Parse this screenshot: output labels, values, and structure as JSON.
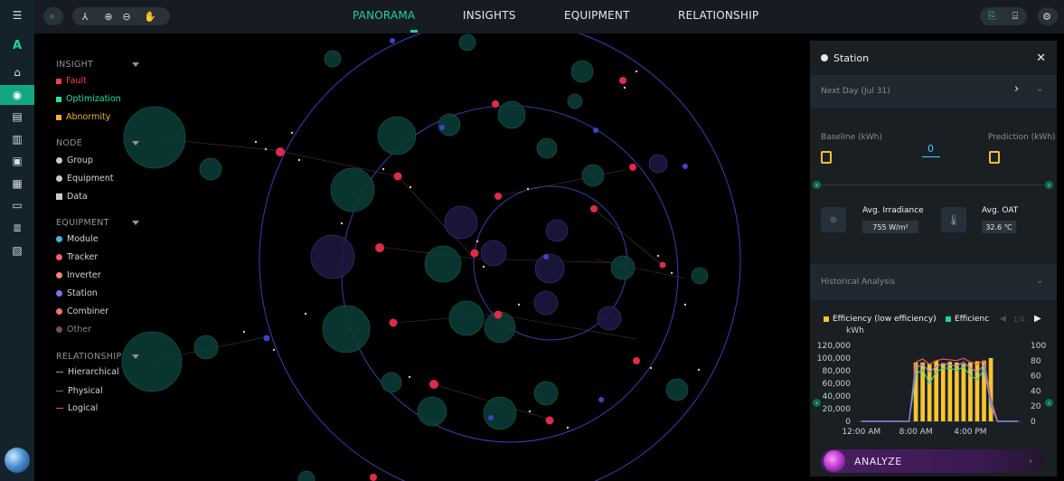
{
  "sidebar": {
    "logo": "A",
    "items": [
      {
        "icon": "menu-icon"
      },
      {
        "icon": "home-icon"
      },
      {
        "icon": "topology-icon"
      },
      {
        "icon": "report-icon"
      },
      {
        "icon": "bar-chart-icon"
      },
      {
        "icon": "monitor-icon"
      },
      {
        "icon": "analytics-icon"
      },
      {
        "icon": "screen-icon"
      },
      {
        "icon": "list-icon"
      },
      {
        "icon": "document-icon"
      }
    ]
  },
  "topbar": {
    "tabs": [
      "PANORAMA",
      "INSIGHTS",
      "EQUIPMENT",
      "RELATIONSHIP"
    ],
    "active_tab": "PANORAMA",
    "tools": [
      "search-icon",
      "hierarchy-icon",
      "zoom-in-icon",
      "zoom-out-icon",
      "pan-hand-icon"
    ],
    "right_tools": [
      "export-icon",
      "clipboard-icon",
      "settings-icon"
    ]
  },
  "legend": {
    "insight_title": "INSIGHT",
    "insight_items": [
      {
        "label": "Fault",
        "color": "#ff3b4e"
      },
      {
        "label": "Optimization",
        "color": "#1fe5a9"
      },
      {
        "label": "Abnormity",
        "color": "#f6b323"
      }
    ],
    "node_title": "NODE",
    "node_items": [
      {
        "label": "Group"
      },
      {
        "label": "Equipment"
      },
      {
        "label": "Data"
      }
    ],
    "equipment_title": "EQUIPMENT",
    "equipment_items": [
      {
        "label": "Module",
        "color": "#46b4d9"
      },
      {
        "label": "Tracker",
        "color": "#ff5a73"
      },
      {
        "label": "Inverter",
        "color": "#f5836c"
      },
      {
        "label": "Station",
        "color": "#8f6cf3"
      },
      {
        "label": "Combiner",
        "color": "#f2795a"
      },
      {
        "label": "Other",
        "color": "#7a4a66"
      }
    ],
    "relationship_title": "RELATIONSHIP",
    "relationship_items": [
      {
        "label": "Hierarchical",
        "color": "#c08a8a"
      },
      {
        "label": "Physical",
        "color": "#2f8d6d"
      },
      {
        "label": "Logical",
        "color": "#d05a63"
      }
    ]
  },
  "panel": {
    "title": "Station",
    "next_day": "Next Day (Jul 31)",
    "baseline_label": "Baseline (kWh)",
    "prediction_label": "Prediction (kWh)",
    "center_value": "0",
    "irradiance_label": "Avg. Irradiance",
    "irradiance_value": "755 W/m²",
    "oat_label": "Avg. OAT",
    "oat_value": "32.6 ℃",
    "historical_label": "Historical Analysis",
    "legend_efficiency_low": "Efficiency (low efficiency)",
    "legend_efficiency_cut": "Efficienc",
    "page_indicator": "1/4",
    "unit_kwh": "kWh",
    "analyze_label": "ANALYZE"
  },
  "chart_data": {
    "type": "bar",
    "categories": [
      "12:00 AM",
      "1:00 AM",
      "2:00 AM",
      "3:00 AM",
      "4:00 AM",
      "5:00 AM",
      "6:00 AM",
      "7:00 AM",
      "8:00 AM",
      "9:00 AM",
      "10:00 AM",
      "11:00 AM",
      "12:00 PM",
      "1:00 PM",
      "2:00 PM",
      "3:00 PM",
      "4:00 PM",
      "5:00 PM",
      "6:00 PM",
      "7:00 PM",
      "8:00 PM",
      "9:00 PM",
      "10:00 PM",
      "11:00 PM"
    ],
    "x_tick_labels": [
      "12:00 AM",
      "8:00 AM",
      "4:00 PM"
    ],
    "y_left_ticks": [
      "120,000",
      "100,000",
      "80,000",
      "60,000",
      "40,000",
      "20,000",
      "0"
    ],
    "y_right_ticks": [
      "100",
      "80",
      "60",
      "40",
      "20",
      "0"
    ],
    "ylabel": "kWh",
    "ylim": [
      0,
      120000
    ],
    "y2lim": [
      0,
      100
    ],
    "series": [
      {
        "name": "Efficiency (low efficiency)",
        "kind": "bar",
        "axis": "left",
        "color": "#f6c42d",
        "values": [
          0,
          0,
          0,
          0,
          0,
          0,
          0,
          0,
          93000,
          93000,
          91000,
          96000,
          92000,
          94000,
          93000,
          91000,
          93000,
          95000,
          96000,
          100000,
          0,
          0,
          0,
          0
        ]
      },
      {
        "kind": "line",
        "axis": "right",
        "color": "#1fd3a6",
        "values": [
          0,
          0,
          0,
          0,
          0,
          0,
          0,
          0,
          62,
          68,
          50,
          65,
          70,
          70,
          67,
          72,
          60,
          55,
          68,
          25,
          0,
          0,
          0,
          0
        ]
      },
      {
        "kind": "line",
        "axis": "right",
        "color": "#e5595a",
        "values": [
          0,
          0,
          0,
          0,
          0,
          0,
          0,
          0,
          78,
          82,
          75,
          80,
          82,
          81,
          80,
          83,
          78,
          75,
          80,
          30,
          0,
          0,
          0,
          0
        ]
      },
      {
        "kind": "line",
        "axis": "right",
        "color": "#8b86f0",
        "values": [
          0,
          0,
          0,
          0,
          0,
          0,
          0,
          0,
          70,
          75,
          65,
          72,
          76,
          74,
          73,
          78,
          70,
          65,
          74,
          20,
          0,
          0,
          0,
          0
        ]
      }
    ]
  }
}
